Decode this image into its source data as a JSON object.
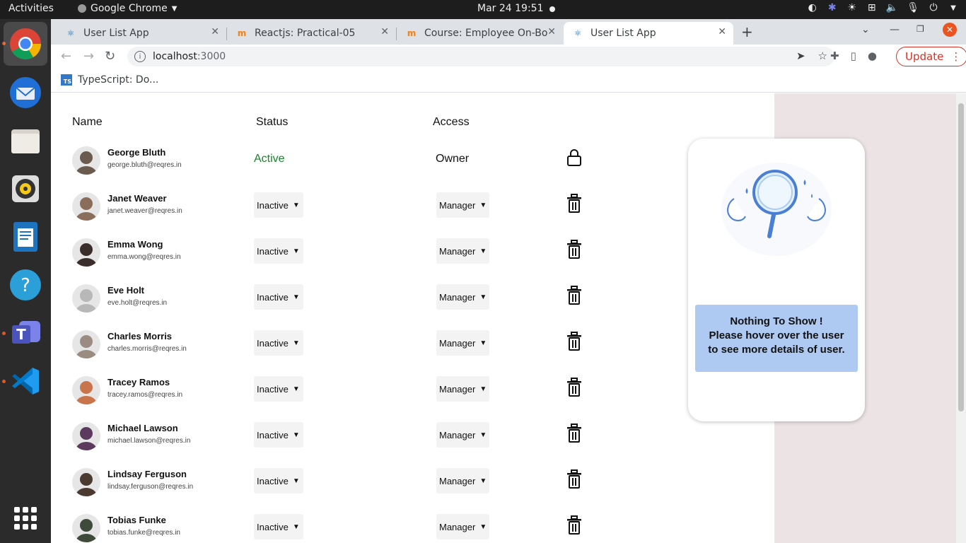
{
  "system": {
    "activities": "Activities",
    "app_name": "Google Chrome",
    "datetime": "Mar 24  19:51"
  },
  "tabs": [
    {
      "title": "User List App",
      "favicon": "react-icon",
      "active": false
    },
    {
      "title": "Reactjs: Practical-05",
      "favicon": "moodle-icon",
      "active": false
    },
    {
      "title": "Course: Employee On-Boa",
      "favicon": "moodle-icon",
      "active": false
    },
    {
      "title": "User List App",
      "favicon": "react-icon",
      "active": true
    }
  ],
  "address": {
    "host": "localhost",
    "port": ":3000"
  },
  "update_label": "Update",
  "bookmarks": [
    {
      "label": "TypeScript: Do..."
    }
  ],
  "table": {
    "headers": {
      "name": "Name",
      "status": "Status",
      "access": "Access"
    },
    "users": [
      {
        "name": "George Bluth",
        "email": "george.bluth@reqres.in",
        "status": "Active",
        "access": "Owner",
        "owner": true
      },
      {
        "name": "Janet Weaver",
        "email": "janet.weaver@reqres.in",
        "status": "Inactive",
        "access": "Manager"
      },
      {
        "name": "Emma Wong",
        "email": "emma.wong@reqres.in",
        "status": "Inactive",
        "access": "Manager"
      },
      {
        "name": "Eve Holt",
        "email": "eve.holt@reqres.in",
        "status": "Inactive",
        "access": "Manager"
      },
      {
        "name": "Charles Morris",
        "email": "charles.morris@reqres.in",
        "status": "Inactive",
        "access": "Manager"
      },
      {
        "name": "Tracey Ramos",
        "email": "tracey.ramos@reqres.in",
        "status": "Inactive",
        "access": "Manager"
      },
      {
        "name": "Michael Lawson",
        "email": "michael.lawson@reqres.in",
        "status": "Inactive",
        "access": "Manager"
      },
      {
        "name": "Lindsay Ferguson",
        "email": "lindsay.ferguson@reqres.in",
        "status": "Inactive",
        "access": "Manager"
      },
      {
        "name": "Tobias Funke",
        "email": "tobias.funke@reqres.in",
        "status": "Inactive",
        "access": "Manager"
      }
    ]
  },
  "details_card": {
    "line1": "Nothing To Show !",
    "line2": "Please hover over the user",
    "line3": "to see more details of user."
  },
  "colors": {
    "active_status": "#17852a",
    "message_bg": "#aecaf2",
    "side_panel_bg": "#ebe3e4",
    "ubuntu_accent": "#e95420"
  }
}
